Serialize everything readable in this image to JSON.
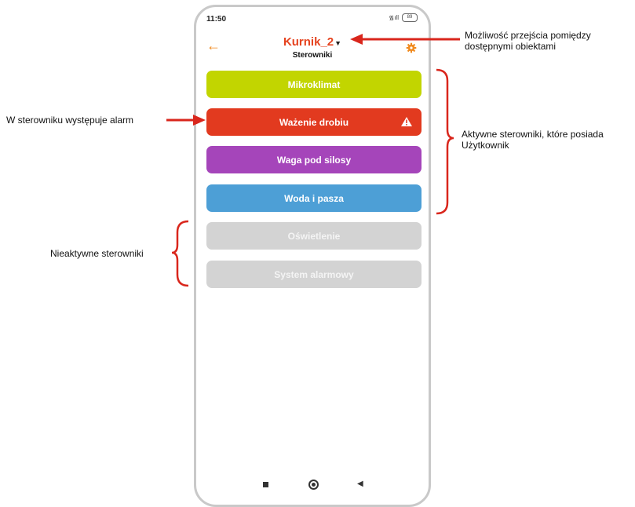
{
  "status_bar": {
    "time": "11:50",
    "signal": "᯾ıll",
    "battery": "89"
  },
  "header": {
    "back_icon": "arrow-left-icon",
    "title": "Kurnik_2",
    "subtitle": "Sterowniki",
    "settings_icon": "gear-icon"
  },
  "controllers": [
    {
      "label": "Mikroklimat",
      "color": "#c2d500",
      "active": true
    },
    {
      "label": "Ważenie drobiu",
      "color": "#e23a1f",
      "active": true,
      "alarm": true
    },
    {
      "label": "Waga pod silosy",
      "color": "#a545ba",
      "active": true
    },
    {
      "label": "Woda i pasza",
      "color": "#4d9fd6",
      "active": true
    },
    {
      "label": "Oświetlenie",
      "color": "#d3d3d3",
      "active": false
    },
    {
      "label": "System alarmowy",
      "color": "#d3d3d3",
      "active": false
    }
  ],
  "annotations": {
    "switch_objects": "Możliwość przejścia pomiędzy\ndostępnymi obiektami",
    "alarm": "W sterowniku występuje alarm",
    "active": "Aktywne sterowniki, które posiada\nUżytkownik",
    "inactive": "Nieaktywne sterowniki"
  },
  "accent_color": "#e5431f"
}
